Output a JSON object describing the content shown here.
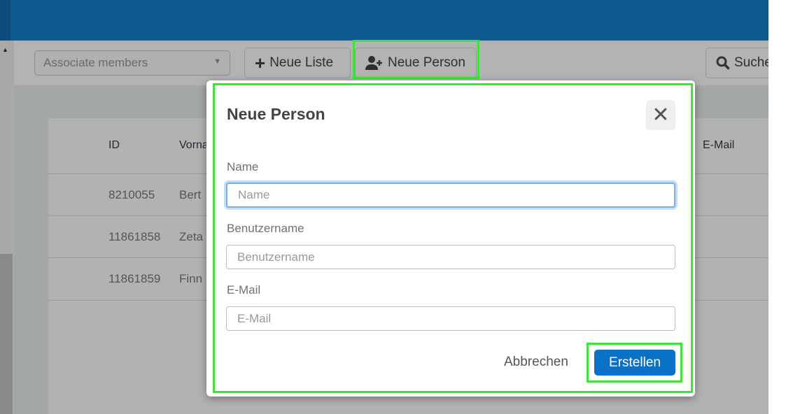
{
  "toolbar": {
    "list_select": "Associate members",
    "new_list_label": "Neue Liste",
    "new_person_label": "Neue Person",
    "search_label": "Suche"
  },
  "table": {
    "headers": [
      "ID",
      "Vorname",
      "E-Mail"
    ],
    "rows": [
      {
        "id": "8210055",
        "first_name": "Bert"
      },
      {
        "id": "11861858",
        "first_name": "Zeta"
      },
      {
        "id": "11861859",
        "first_name": "Finn"
      }
    ]
  },
  "modal": {
    "title": "Neue Person",
    "fields": [
      {
        "label": "Name",
        "placeholder": "Name",
        "value": ""
      },
      {
        "label": "Benutzername",
        "placeholder": "Benutzername",
        "value": ""
      },
      {
        "label": "E-Mail",
        "placeholder": "E-Mail",
        "value": ""
      }
    ],
    "cancel_label": "Abbrechen",
    "create_label": "Erstellen"
  },
  "colors": {
    "header": "#0e5a91",
    "primary": "#0a72c6",
    "highlight": "#3fe43a"
  }
}
